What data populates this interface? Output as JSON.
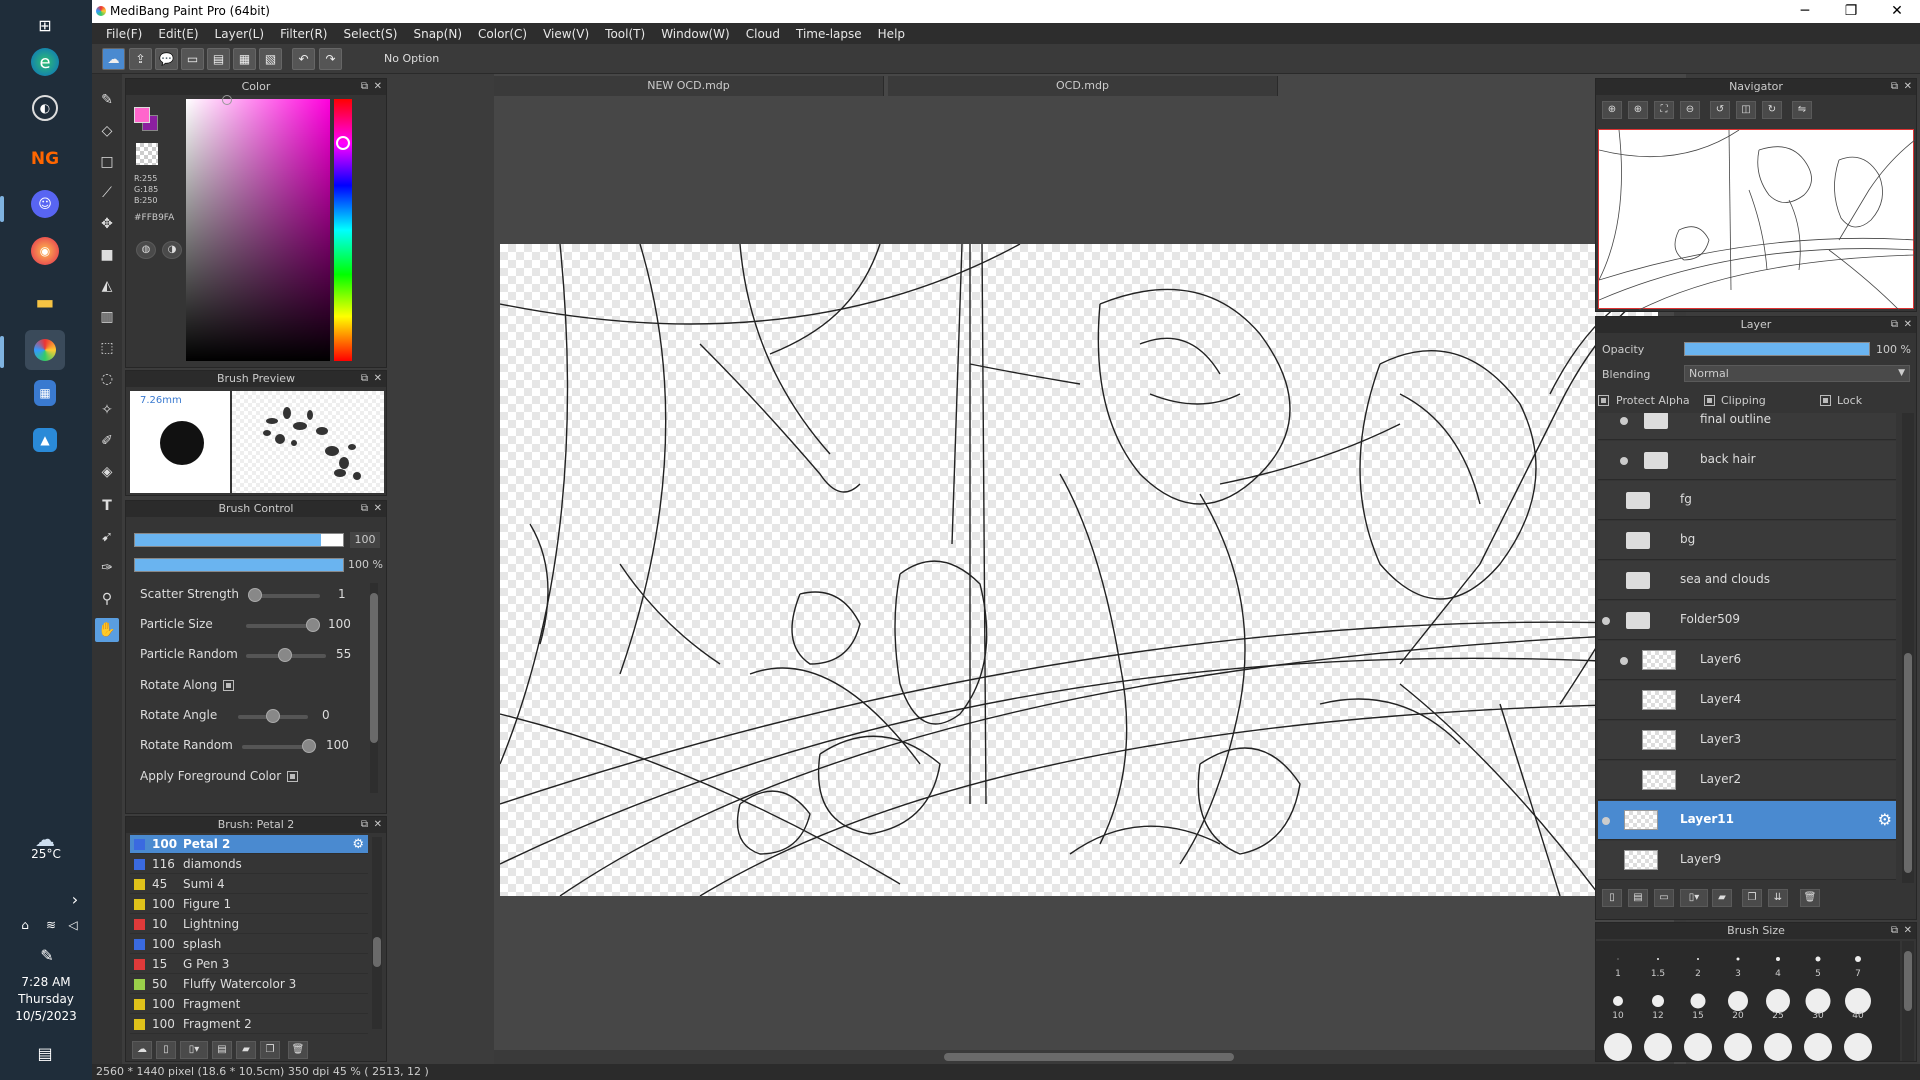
{
  "taskbar": {
    "weather_temp": "25°C",
    "time": "7:28 AM",
    "day": "Thursday",
    "date": "10/5/2023"
  },
  "window": {
    "title": "MediBang Paint Pro (64bit)"
  },
  "menu": [
    "File(F)",
    "Edit(E)",
    "Layer(L)",
    "Filter(R)",
    "Select(S)",
    "Snap(N)",
    "Color(C)",
    "View(V)",
    "Tool(T)",
    "Window(W)",
    "Cloud",
    "Time-lapse",
    "Help"
  ],
  "toolbar": {
    "option_text": "No Option"
  },
  "color_panel": {
    "title": "Color",
    "r": "R:255",
    "g": "G:185",
    "b": "B:250",
    "hex": "#FFB9FA",
    "foreground": "#ff66cc",
    "background": "#8b1fa0"
  },
  "brush_preview": {
    "title": "Brush Preview",
    "size": "7.26mm"
  },
  "brush_control": {
    "title": "Brush Control",
    "size_value": "100",
    "opacity_value": "100 %",
    "sliders": [
      {
        "label": "Scatter Strength",
        "value": "1",
        "pos": 0.0
      },
      {
        "label": "Particle Size",
        "value": "100",
        "pos": 1.0
      },
      {
        "label": "Particle Random",
        "value": "55",
        "pos": 0.55
      },
      {
        "label": "Rotate Angle",
        "value": "0",
        "pos": 0.5
      },
      {
        "label": "Rotate Random",
        "value": "100",
        "pos": 1.0
      }
    ],
    "rotate_along": "Rotate Along",
    "apply_fg": "Apply Foreground Color"
  },
  "brush_list": {
    "title": "Brush: Petal 2",
    "items": [
      {
        "size": "100",
        "name": "Petal 2",
        "color": "#3a6ae0",
        "selected": true
      },
      {
        "size": "116",
        "name": "diamonds",
        "color": "#3a6ae0"
      },
      {
        "size": "45",
        "name": "Sumi 4",
        "color": "#e0c21a"
      },
      {
        "size": "100",
        "name": "Figure 1",
        "color": "#e0c21a"
      },
      {
        "size": "10",
        "name": "Lightning",
        "color": "#e03a3a"
      },
      {
        "size": "100",
        "name": "splash",
        "color": "#3a6ae0"
      },
      {
        "size": "15",
        "name": "G Pen 3",
        "color": "#e03a3a"
      },
      {
        "size": "50",
        "name": "Fluffy Watercolor 3",
        "color": "#9ad04a"
      },
      {
        "size": "100",
        "name": "Fragment",
        "color": "#e0c21a"
      },
      {
        "size": "100",
        "name": "Fragment 2",
        "color": "#e0c21a"
      }
    ]
  },
  "documents": {
    "tabs": [
      "NEW OCD.mdp",
      "OCD.mdp"
    ]
  },
  "navigator": {
    "title": "Navigator"
  },
  "layer_panel": {
    "title": "Layer",
    "opacity_label": "Opacity",
    "opacity_value": "100 %",
    "blending_label": "Blending",
    "blending_value": "Normal",
    "protect_alpha": "Protect Alpha",
    "clipping": "Clipping",
    "lock": "Lock",
    "layers": [
      {
        "name": "final outline",
        "type": "folder",
        "indent": 2,
        "visible": true
      },
      {
        "name": "back hair",
        "type": "folder",
        "indent": 2,
        "visible": true
      },
      {
        "name": "fg",
        "type": "folder",
        "indent": 1,
        "visible": false
      },
      {
        "name": "bg",
        "type": "folder",
        "indent": 1,
        "visible": false
      },
      {
        "name": "sea and clouds",
        "type": "folder",
        "indent": 1,
        "visible": false
      },
      {
        "name": "Folder509",
        "type": "folder",
        "indent": 1,
        "visible": true
      },
      {
        "name": "Layer6",
        "type": "layer",
        "indent": 2,
        "visible": true
      },
      {
        "name": "Layer4",
        "type": "layer",
        "indent": 2,
        "visible": false
      },
      {
        "name": "Layer3",
        "type": "layer",
        "indent": 2,
        "visible": false
      },
      {
        "name": "Layer2",
        "type": "layer",
        "indent": 2,
        "visible": false
      },
      {
        "name": "Layer11",
        "type": "layer",
        "indent": 1,
        "visible": true,
        "selected": true
      },
      {
        "name": "Layer9",
        "type": "layer",
        "indent": 1,
        "visible": false
      }
    ]
  },
  "brush_size": {
    "title": "Brush Size",
    "row1": [
      "1",
      "1.5",
      "2",
      "3",
      "4",
      "5",
      "7"
    ],
    "row2": [
      "10",
      "12",
      "15",
      "20",
      "25",
      "30",
      "40"
    ]
  },
  "status": {
    "text": "2560 * 1440 pixel  (18.6 * 10.5cm)  350 dpi  45 %  ( 2513, 12 )"
  }
}
